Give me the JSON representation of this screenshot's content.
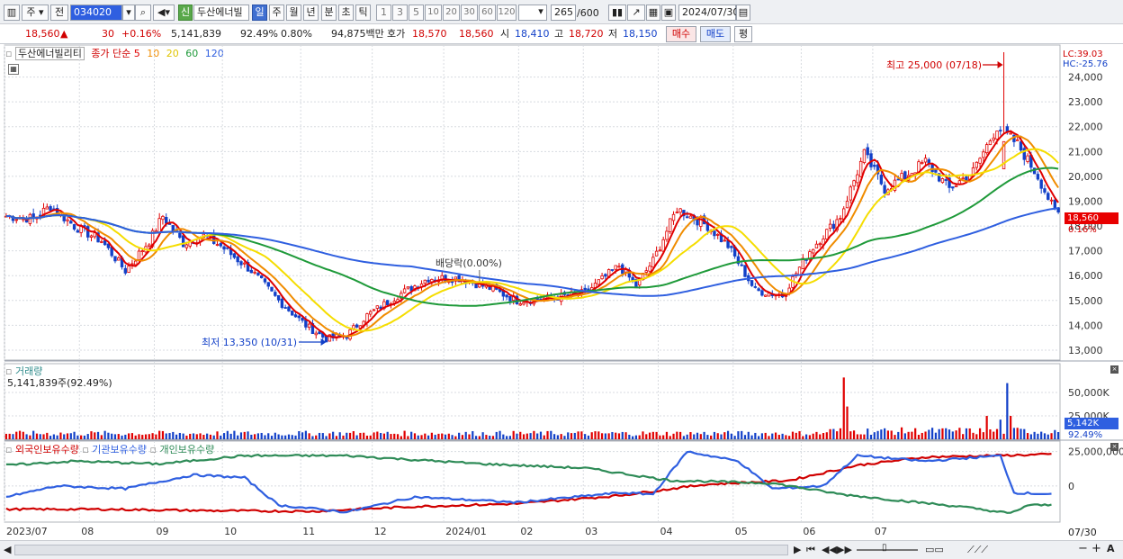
{
  "toolbar": {
    "market": "주",
    "prev": "전",
    "code": "034020",
    "info": "신",
    "stock_name": "두산에너빌",
    "periods": [
      "일",
      "주",
      "월",
      "년",
      "분",
      "초",
      "틱"
    ],
    "active_period": "일",
    "intervals": [
      "1",
      "3",
      "5",
      "10",
      "20",
      "30",
      "60",
      "120"
    ],
    "count": "265",
    "count_max": "/600",
    "date": "2024/07/30"
  },
  "quote": {
    "price": "18,560",
    "change_arrow": "▲",
    "change": "30",
    "change_pct": "+0.16%",
    "volume": "5,141,839",
    "vol_ratio": "92.49%",
    "turnover_pct": "0.80%",
    "amount": "94,875백만",
    "ask_label": "호가",
    "ask1": "18,570",
    "bid1": "18,560",
    "open_label": "시",
    "open": "18,410",
    "high_label": "고",
    "high": "18,720",
    "low_label": "저",
    "low": "18,150",
    "buy_btn": "매수",
    "sell_btn": "매도",
    "eval_btn": "평"
  },
  "legend": {
    "stock": "두산에너빌리티",
    "ma_label": "종가 단순",
    "ma": [
      "5",
      "10",
      "20",
      "60",
      "120"
    ],
    "ma_colors": [
      "#e00000",
      "#f08c00",
      "#f5dd00",
      "#1f9a3a",
      "#2f5fe0"
    ]
  },
  "price_panel": {
    "lc": "LC:39.03",
    "hc": "HC:-25.76",
    "current_tag": "18,560",
    "current_pct": "0.16%",
    "high_note": "최고 25,000 (07/18)",
    "low_note": "최저 13,350 (10/31)",
    "dividend_note": "배당락(0.00%)"
  },
  "volume_panel": {
    "title": "거래량",
    "value": "5,141,839주(92.49%)",
    "tag": "5,142K",
    "tag_pct": "92.49%"
  },
  "holdings_panel": {
    "titles": [
      "외국인보유수량",
      "기관보유수량",
      "개인보유수량"
    ],
    "colors": [
      "#d00000",
      "#2f5fe0",
      "#2e8b57"
    ]
  },
  "x_axis": {
    "labels": [
      "2023/07",
      "08",
      "09",
      "10",
      "11",
      "12",
      "2024/01",
      "02",
      "03",
      "04",
      "05",
      "06",
      "07"
    ],
    "right_label": "07/30"
  },
  "chart_data": [
    {
      "type": "candlestick",
      "title": "두산에너빌리티",
      "y_ticks": [
        13000,
        14000,
        15000,
        16000,
        17000,
        18000,
        19000,
        20000,
        21000,
        22000,
        23000,
        24000
      ],
      "ylim": [
        12600,
        25000
      ],
      "close_anchors": [
        [
          0,
          18400
        ],
        [
          8,
          18300
        ],
        [
          13,
          18800
        ],
        [
          20,
          18000
        ],
        [
          28,
          17400
        ],
        [
          35,
          16200
        ],
        [
          42,
          17400
        ],
        [
          46,
          18400
        ],
        [
          52,
          17300
        ],
        [
          58,
          17600
        ],
        [
          63,
          17200
        ],
        [
          72,
          16200
        ],
        [
          80,
          15000
        ],
        [
          88,
          14000
        ],
        [
          94,
          13450
        ],
        [
          100,
          13600
        ],
        [
          106,
          14400
        ],
        [
          115,
          15200
        ],
        [
          124,
          15900
        ],
        [
          133,
          15900
        ],
        [
          142,
          15500
        ],
        [
          150,
          15000
        ],
        [
          160,
          15100
        ],
        [
          170,
          15300
        ],
        [
          180,
          16400
        ],
        [
          185,
          15600
        ],
        [
          190,
          16600
        ],
        [
          197,
          18700
        ],
        [
          206,
          18000
        ],
        [
          212,
          17200
        ],
        [
          220,
          15400
        ],
        [
          228,
          15200
        ],
        [
          236,
          17000
        ],
        [
          245,
          18400
        ],
        [
          252,
          20900
        ],
        [
          258,
          19500
        ],
        [
          264,
          20000
        ],
        [
          270,
          20600
        ],
        [
          277,
          19500
        ],
        [
          284,
          20200
        ],
        [
          291,
          22000
        ],
        [
          297,
          21300
        ],
        [
          303,
          20000
        ],
        [
          308,
          18560
        ]
      ],
      "high_price": 25000,
      "low_price": 13350,
      "last_close": 18560
    },
    {
      "type": "bar",
      "title": "거래량",
      "y_ticks": [
        "25,000K",
        "50,000K"
      ],
      "ylim": [
        0,
        75000
      ],
      "spikes": [
        [
          246,
          66000
        ],
        [
          247,
          35000
        ],
        [
          288,
          25000
        ],
        [
          292,
          21000
        ],
        [
          294,
          60000
        ],
        [
          295,
          25000
        ]
      ],
      "base_volume": 6500
    },
    {
      "type": "line",
      "title": "외국인보유수량 / 기관보유수량 / 개인보유수량",
      "y_ticks": [
        "0",
        "25,000,000"
      ],
      "series": [
        {
          "name": "외국인보유수량",
          "anchors": [
            [
              0,
              -17000000
            ],
            [
              30,
              -17000000
            ],
            [
              60,
              -18000000
            ],
            [
              90,
              -18500000
            ],
            [
              120,
              -15000000
            ],
            [
              150,
              -13000000
            ],
            [
              180,
              -7000000
            ],
            [
              205,
              1000000
            ],
            [
              230,
              4000000
            ],
            [
              250,
              15000000
            ],
            [
              270,
              21000000
            ],
            [
              308,
              23000000
            ]
          ]
        },
        {
          "name": "기관보유수량",
          "anchors": [
            [
              0,
              -8000000
            ],
            [
              15,
              0
            ],
            [
              35,
              -2000000
            ],
            [
              55,
              8000000
            ],
            [
              70,
              6000000
            ],
            [
              80,
              -14000000
            ],
            [
              100,
              -19000000
            ],
            [
              120,
              -8000000
            ],
            [
              150,
              -12000000
            ],
            [
              180,
              -5000000
            ],
            [
              190,
              -6000000
            ],
            [
              200,
              25000000
            ],
            [
              215,
              18000000
            ],
            [
              225,
              -2000000
            ],
            [
              240,
              0
            ],
            [
              250,
              22000000
            ],
            [
              270,
              18000000
            ],
            [
              292,
              22000000
            ],
            [
              296,
              -5000000
            ],
            [
              308,
              -6000000
            ]
          ]
        },
        {
          "name": "개인보유수량",
          "anchors": [
            [
              0,
              15000000
            ],
            [
              20,
              18000000
            ],
            [
              45,
              16000000
            ],
            [
              70,
              22000000
            ],
            [
              100,
              22000000
            ],
            [
              140,
              16000000
            ],
            [
              170,
              13000000
            ],
            [
              195,
              4000000
            ],
            [
              225,
              2000000
            ],
            [
              245,
              -6000000
            ],
            [
              260,
              -10000000
            ],
            [
              280,
              -15000000
            ],
            [
              295,
              -20000000
            ],
            [
              300,
              -14000000
            ],
            [
              308,
              -14000000
            ]
          ]
        }
      ]
    }
  ]
}
